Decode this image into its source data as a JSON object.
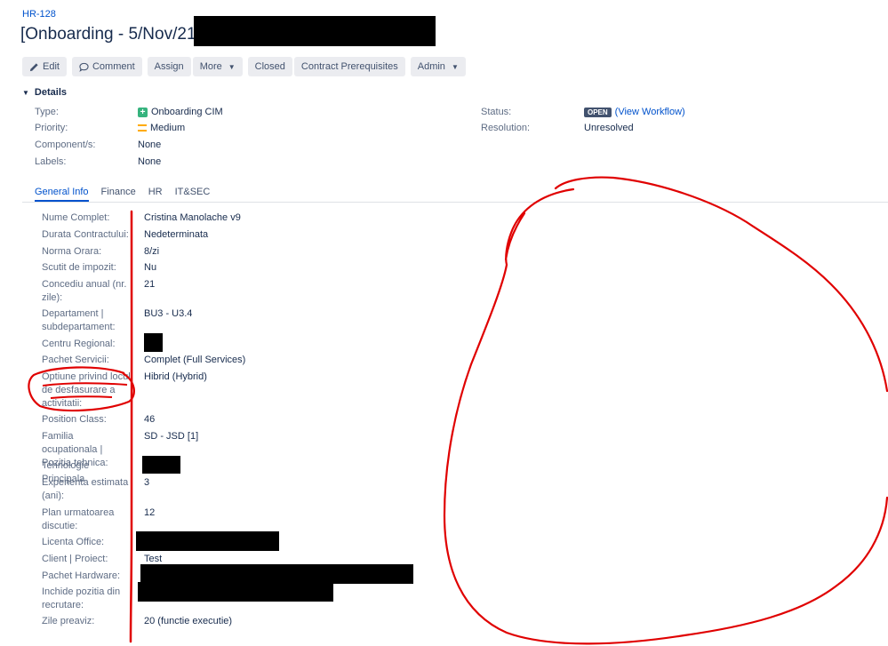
{
  "issue": {
    "key": "HR-128",
    "title": "[Onboarding - 5/Nov/21]"
  },
  "toolbar": {
    "edit": "Edit",
    "comment": "Comment",
    "assign": "Assign",
    "more": "More",
    "closed": "Closed",
    "contract": "Contract Prerequisites",
    "admin": "Admin"
  },
  "details": {
    "heading": "Details",
    "type_label": "Type:",
    "type_value": "Onboarding CIM",
    "priority_label": "Priority:",
    "priority_value": "Medium",
    "components_label": "Component/s:",
    "components_value": "None",
    "labels_label": "Labels:",
    "labels_value": "None",
    "status_label": "Status:",
    "status_value": "OPEN",
    "workflow_link": "(View Workflow)",
    "resolution_label": "Resolution:",
    "resolution_value": "Unresolved"
  },
  "tabs": [
    "General Info",
    "Finance",
    "HR",
    "IT&SEC"
  ],
  "fields": [
    {
      "label": "Nume Complet:",
      "value": "Cristina Manolache v9"
    },
    {
      "label": "Durata Contractului:",
      "value": "Nedeterminata"
    },
    {
      "label": "Norma Orara:",
      "value": "8/zi"
    },
    {
      "label": "Scutit de impozit:",
      "value": "Nu"
    },
    {
      "label": "Concediu anual (nr. zile):",
      "value": "21"
    },
    {
      "label": "Departament | subdepartament:",
      "value": "BU3 - U3.4"
    },
    {
      "label": "Centru Regional:",
      "value": ""
    },
    {
      "label": "Pachet Servicii:",
      "value": "Complet (Full Services)"
    },
    {
      "label": "Optiune privind locul de desfasurare a activitatii:",
      "value": "Hibrid (Hybrid)"
    },
    {
      "label": "Position Class:",
      "value": "46"
    },
    {
      "label": "Familia ocupationala | Pozitia tehnica:",
      "value": "SD - JSD [1]"
    },
    {
      "label": "Tehnologie Principala",
      "value": ""
    },
    {
      "label": "Experienta estimata (ani):",
      "value": "3"
    },
    {
      "label": "Plan urmatoarea discutie:",
      "value": "12"
    },
    {
      "label": "Licenta Office:",
      "value": ""
    },
    {
      "label": "Client | Proiect:",
      "value": "Test"
    },
    {
      "label": "Pachet Hardware:",
      "value": ""
    },
    {
      "label": "Inchide pozitia din recrutare:",
      "value": ""
    },
    {
      "label": "Zile preaviz:",
      "value": "20 (functie executie)"
    }
  ]
}
